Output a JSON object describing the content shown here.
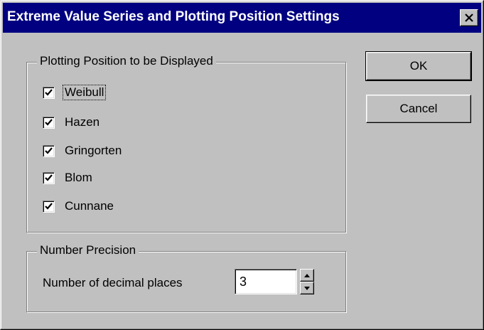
{
  "window": {
    "title": "Extreme Value Series and Plotting Position Settings",
    "close_icon": "close-icon"
  },
  "plotting_group": {
    "legend": "Plotting Position to be Displayed",
    "options": [
      {
        "label": "Weibull",
        "checked": true,
        "focused": true
      },
      {
        "label": "Hazen",
        "checked": true
      },
      {
        "label": "Gringorten",
        "checked": true
      },
      {
        "label": "Blom",
        "checked": true
      },
      {
        "label": "Cunnane",
        "checked": true
      }
    ]
  },
  "precision_group": {
    "legend": "Number Precision",
    "label": "Number of decimal places",
    "value": "3"
  },
  "buttons": {
    "ok": "OK",
    "cancel": "Cancel"
  },
  "colors": {
    "titlebar": "#000080",
    "face": "#c0c0c0"
  }
}
